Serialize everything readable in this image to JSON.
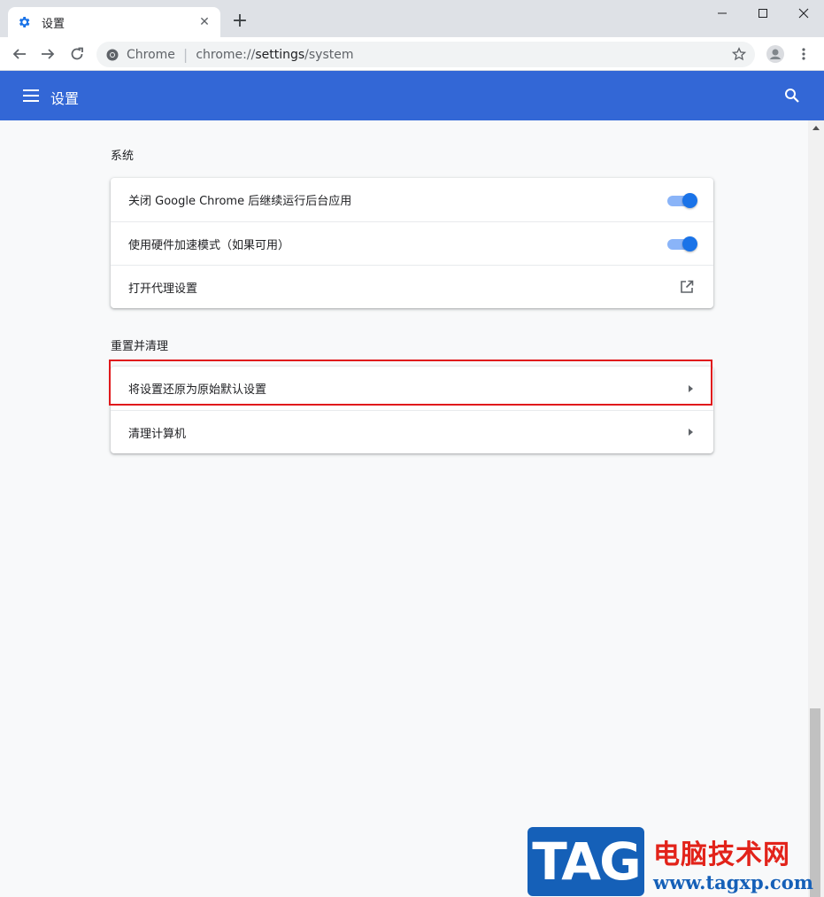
{
  "browser": {
    "tab_title": "设置",
    "new_tab_symbol": "+",
    "tab_close_symbol": "✕",
    "site_name": "Chrome",
    "url_scheme": "chrome://",
    "url_host": "settings",
    "url_path": "/system"
  },
  "appbar": {
    "title": "设置",
    "bg_color": "#3367d6"
  },
  "sections": {
    "system": {
      "title": "系统",
      "rows": [
        {
          "label": "关闭 Google Chrome 后继续运行后台应用",
          "control": "toggle",
          "checked": true
        },
        {
          "label": "使用硬件加速模式（如果可用）",
          "control": "toggle",
          "checked": true
        },
        {
          "label": "打开代理设置",
          "control": "open-in-new-icon"
        }
      ]
    },
    "reset": {
      "title": "重置并清理",
      "rows": [
        {
          "label": "将设置还原为原始默认设置",
          "control": "arrow-right-icon",
          "highlighted": true
        },
        {
          "label": "清理计算机",
          "control": "arrow-right-icon"
        }
      ]
    }
  },
  "watermark": {
    "logo_text": "TAG",
    "site_cn": "电脑技术网",
    "site_url": "www.tagxp.com"
  },
  "colors": {
    "toggle_on": "#1a73e8",
    "highlight_border": "#e0191c"
  }
}
